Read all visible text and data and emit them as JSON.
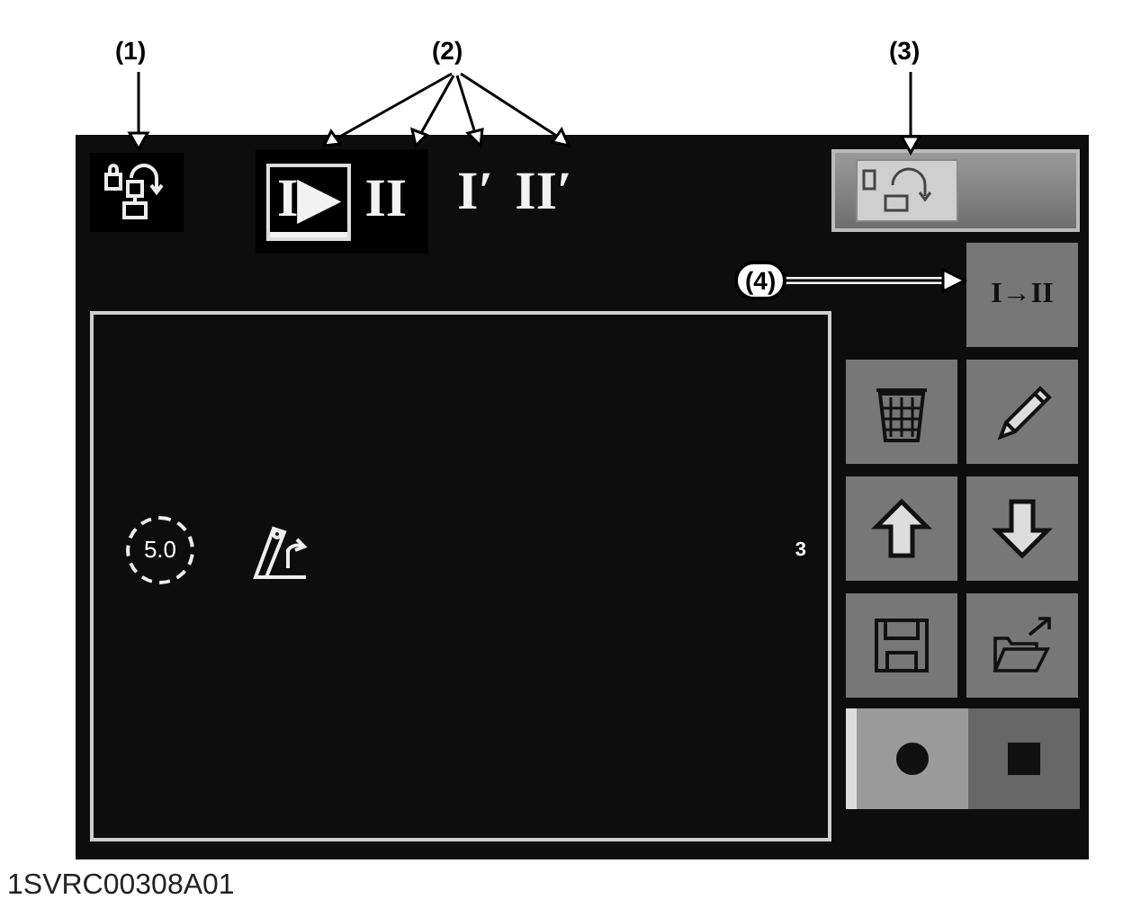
{
  "callouts": [
    {
      "label": "(1)"
    },
    {
      "label": "(2)"
    },
    {
      "label": "(3)"
    },
    {
      "label": "(4)"
    }
  ],
  "pattern_tabs": [
    {
      "label": "I▶",
      "selected": true
    },
    {
      "label": "II",
      "selected": false
    }
  ],
  "alt_patterns": [
    {
      "label": "I′"
    },
    {
      "label": "II′"
    }
  ],
  "copy_button": {
    "label": "I→II"
  },
  "speed": {
    "value": "5.0"
  },
  "row_number": "3",
  "tools": [
    {
      "kind": "trash"
    },
    {
      "kind": "pencil"
    },
    {
      "kind": "up"
    },
    {
      "kind": "down"
    },
    {
      "kind": "save"
    },
    {
      "kind": "open"
    }
  ],
  "record": {
    "on": true
  },
  "caption": "1SVRC00308A01"
}
